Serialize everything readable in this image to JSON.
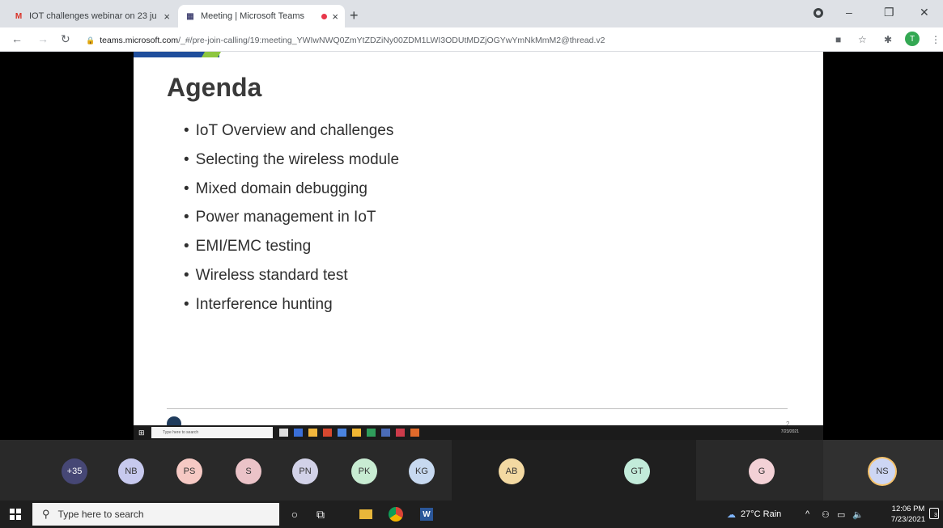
{
  "browser": {
    "tabs": [
      {
        "title": "IOT challenges webinar on 23 ju",
        "favicon": "gmail-icon",
        "active": false
      },
      {
        "title": "Meeting | Microsoft Teams",
        "favicon": "teams-icon",
        "active": true,
        "recording": true
      }
    ],
    "new_tab": "+",
    "close_glyph": "×",
    "url_host": "teams.microsoft.com",
    "url_path": "/_#/pre-join-calling/19:meeting_YWIwNWQ0ZmYtZDZiNy00ZDM1LWI3ODUtMDZjOGYwYmNkMmM2@thread.v2",
    "profile_initial": "T",
    "window_controls": {
      "minimize": "–",
      "restore": "❐",
      "close": "✕"
    }
  },
  "slide": {
    "title": "Agenda",
    "items": [
      "IoT Overview and challenges",
      "Selecting the wireless module",
      "Mixed domain debugging",
      "Power management in IoT",
      "EMI/EMC testing",
      "Wireless standard test",
      "Interference hunting"
    ],
    "page_number": "2",
    "mini_taskbar_search": "Type here to search"
  },
  "participants": [
    {
      "initials": "+35",
      "color": "#464775"
    },
    {
      "initials": "NB",
      "color": "#c7c9ee"
    },
    {
      "initials": "PS",
      "color": "#f6c9c4"
    },
    {
      "initials": "S",
      "color": "#ebc3c8"
    },
    {
      "initials": "PN",
      "color": "#d2d2e8"
    },
    {
      "initials": "PK",
      "color": "#c8ecd2"
    },
    {
      "initials": "KG",
      "color": "#c7d9f0"
    },
    {
      "initials": "AB",
      "color": "#f3d9a2"
    },
    {
      "initials": "GT",
      "color": "#c2ebda"
    },
    {
      "initials": "G",
      "color": "#f3d1d6"
    },
    {
      "initials": "NS",
      "color": "#cdd6f4"
    }
  ],
  "taskbar": {
    "search_placeholder": "Type here to search",
    "weather": "27°C  Rain",
    "time": "12:06 PM",
    "date": "7/23/2021",
    "notification_count": "3"
  },
  "colors": {
    "teams_purple": "#464775",
    "slide_accent_blue": "#1f4e9c",
    "slide_accent_green": "#8dc63f",
    "recording_red": "#e8374a"
  }
}
